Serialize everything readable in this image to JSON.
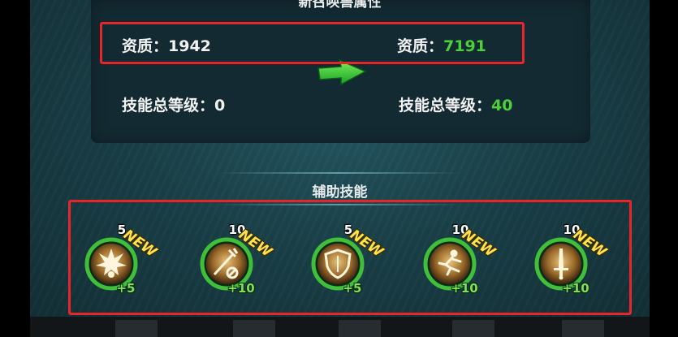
{
  "header": {
    "title": "新召唤兽属性"
  },
  "attributes": {
    "left": {
      "aptitude_label": "资质：",
      "aptitude_value": "1942",
      "skill_level_label": "技能总等级：",
      "skill_level_value": "0"
    },
    "right": {
      "aptitude_label": "资质：",
      "aptitude_value": "7191",
      "skill_level_label": "技能总等级：",
      "skill_level_value": "40"
    }
  },
  "support_skills": {
    "title": "辅助技能",
    "items": [
      {
        "level": "5",
        "tag": "NEW",
        "bonus": "+5",
        "icon": "burst-icon"
      },
      {
        "level": "10",
        "tag": "NEW",
        "bonus": "+10",
        "icon": "broken-strike-icon"
      },
      {
        "level": "5",
        "tag": "NEW",
        "bonus": "+5",
        "icon": "shield-icon"
      },
      {
        "level": "10",
        "tag": "NEW",
        "bonus": "+10",
        "icon": "runner-icon"
      },
      {
        "level": "10",
        "tag": "NEW",
        "bonus": "+10",
        "icon": "sword-icon"
      }
    ]
  },
  "colors": {
    "highlight_box": "#e8262a",
    "value_green": "#4bd23b",
    "new_tag": "#ffe24a",
    "ring_green": "#3fbf3a"
  }
}
